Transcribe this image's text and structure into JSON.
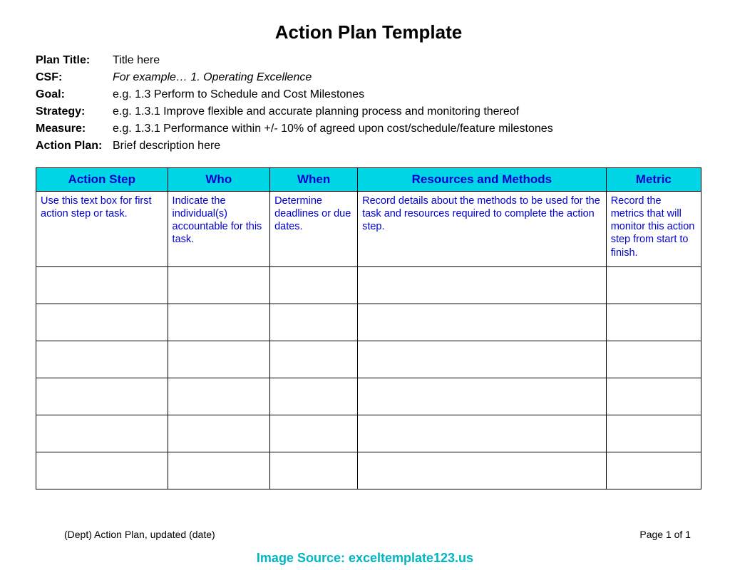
{
  "title": "Action Plan Template",
  "meta": [
    {
      "label": "Plan Title:",
      "value": "Title here",
      "italic": false
    },
    {
      "label": "CSF:",
      "value": "For example… 1. Operating Excellence",
      "italic": true
    },
    {
      "label": "Goal:",
      "value": "e.g. 1.3  Perform to Schedule and Cost Milestones",
      "italic": false
    },
    {
      "label": "Strategy:",
      "value": "e.g. 1.3.1  Improve flexible and accurate planning process and monitoring thereof",
      "italic": false
    },
    {
      "label": "Measure:",
      "value": "e.g. 1.3.1  Performance within +/- 10% of agreed upon cost/schedule/feature milestones",
      "italic": false
    },
    {
      "label": "Action Plan:",
      "value": "Brief description here",
      "italic": false
    }
  ],
  "headers": [
    "Action Step",
    "Who",
    "When",
    "Resources and Methods",
    "Metric"
  ],
  "row1": [
    "Use this text box for first action step or task.",
    "Indicate the individual(s) accountable for this task.",
    "Determine deadlines or due dates.",
    "Record details about the methods to be used for the task and resources required to complete the action step.",
    "Record the metrics that will monitor this action step from start to finish."
  ],
  "footer_left": "(Dept) Action Plan, updated (date)",
  "footer_right": "Page 1 of 1",
  "source": "Image Source: exceltemplate123.us"
}
